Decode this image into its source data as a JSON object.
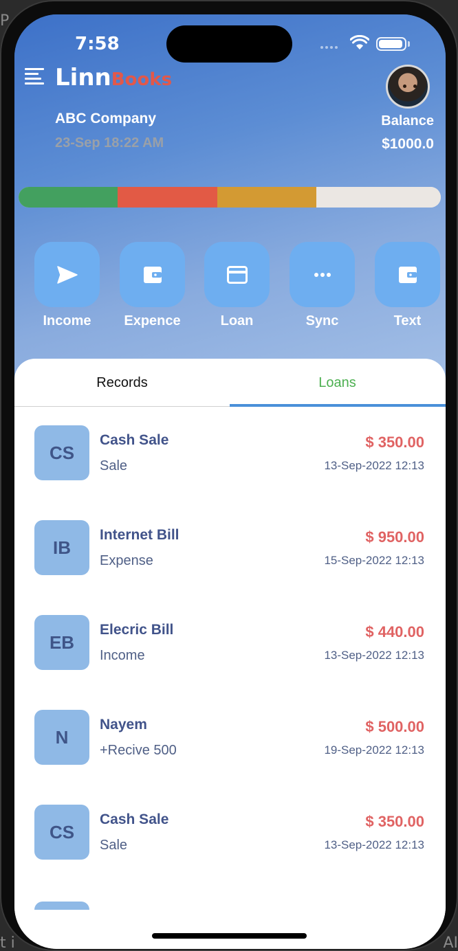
{
  "status_bar": {
    "time": "7:58"
  },
  "app": {
    "brand_primary": "Linn",
    "brand_secondary": "Books"
  },
  "company": {
    "name": "ABC Company",
    "datetime": "23-Sep 18:22 AM"
  },
  "balance": {
    "label": "Balance",
    "value": "$1000.0"
  },
  "summary_bar": {
    "segments": [
      {
        "color": "#43a05f",
        "fraction": 0.235
      },
      {
        "color": "#e25a45",
        "fraction": 0.235
      },
      {
        "color": "#d39a33",
        "fraction": 0.235
      },
      {
        "color": "#ebe7e3",
        "fraction": 0.295
      }
    ]
  },
  "actions": [
    {
      "label": "Income",
      "icon": "send-icon"
    },
    {
      "label": "Expence",
      "icon": "wallet-icon"
    },
    {
      "label": "Loan",
      "icon": "card-icon"
    },
    {
      "label": "Sync",
      "icon": "more-icon"
    },
    {
      "label": "Text",
      "icon": "wallet-icon"
    }
  ],
  "tabs": [
    {
      "label": "Records",
      "active": false
    },
    {
      "label": "Loans",
      "active": true
    }
  ],
  "records": [
    {
      "initials": "CS",
      "title": "Cash Sale",
      "subtitle": "Sale",
      "amount": "$ 350.00",
      "date": "13-Sep-2022 12:13"
    },
    {
      "initials": "IB",
      "title": "Internet Bill",
      "subtitle": "Expense",
      "amount": "$ 950.00",
      "date": "15-Sep-2022 12:13"
    },
    {
      "initials": "EB",
      "title": "Elecric Bill",
      "subtitle": "Income",
      "amount": "$ 440.00",
      "date": "13-Sep-2022 12:13"
    },
    {
      "initials": "N",
      "title": "Nayem",
      "subtitle": "+Recive 500",
      "amount": "$ 500.00",
      "date": "19-Sep-2022 12:13"
    },
    {
      "initials": "CS",
      "title": "Cash Sale",
      "subtitle": "Sale",
      "amount": "$ 350.00",
      "date": "13-Sep-2022 12:13"
    }
  ],
  "colors": {
    "accent": "#4a90d9",
    "amount": "#e06363",
    "active_tab": "#4caf50",
    "action_button": "#6eaef0"
  }
}
